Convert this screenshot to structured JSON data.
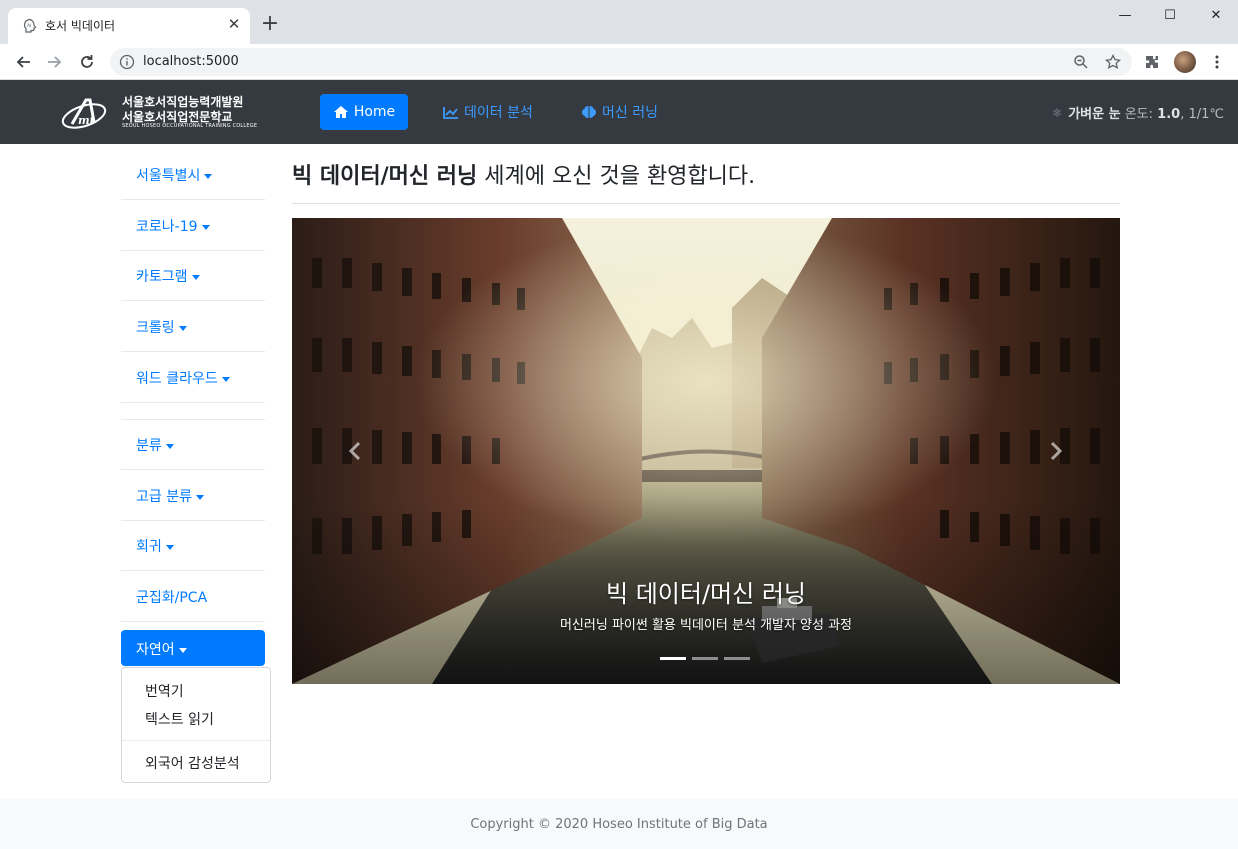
{
  "browser": {
    "tab_title": "호서 빅데이터",
    "url": "localhost:5000",
    "tab_icon": "ai-head-icon"
  },
  "navbar": {
    "logo_line1": "서울호서직업능력개발원",
    "logo_line2": "서울호서직업전문학교",
    "logo_line3": "SEOUL HOSEO OCCUPATIONAL TRAINING COLLEGE",
    "home_label": "Home",
    "data_analysis_label": "데이터 분석",
    "machine_learning_label": "머신 러닝",
    "weather_desc": "가벼운 눈",
    "weather_temp_label": "온도:",
    "weather_temp_value": "1.0",
    "weather_range": ", 1/1℃",
    "colors": {
      "bg": "#343a40",
      "accent": "#007bff",
      "link": "#3b9bff"
    }
  },
  "sidebar": {
    "items": [
      {
        "label": "서울특별시",
        "dropdown": true
      },
      {
        "label": "코로나-19",
        "dropdown": true
      },
      {
        "label": "카토그램",
        "dropdown": true
      },
      {
        "label": "크롤링",
        "dropdown": true
      },
      {
        "label": "워드 클라우드",
        "dropdown": true
      },
      {
        "label": "분류",
        "dropdown": true
      },
      {
        "label": "고급 분류",
        "dropdown": true
      },
      {
        "label": "회귀",
        "dropdown": true
      },
      {
        "label": "군집화/PCA",
        "dropdown": false
      }
    ],
    "active_item": {
      "label": "자연어",
      "dropdown": true
    },
    "dropdown_menu": {
      "items": [
        "번역기",
        "텍스트 읽기"
      ],
      "after_divider": [
        "외국어 감성분석"
      ]
    }
  },
  "main": {
    "heading_bold": "빅 데이터/머신 러닝",
    "heading_rest": "세계에 오신 것을 환영합니다.",
    "carousel": {
      "caption_title": "빅 데이터/머신 러닝",
      "caption_subtitle": "머신러닝 파이썬 활용 빅데이터 분석 개발자 양성 과정",
      "slide_count": 3,
      "active_slide": 1
    }
  },
  "footer": {
    "text": "Copyright © 2020 Hoseo Institute of Big Data"
  }
}
